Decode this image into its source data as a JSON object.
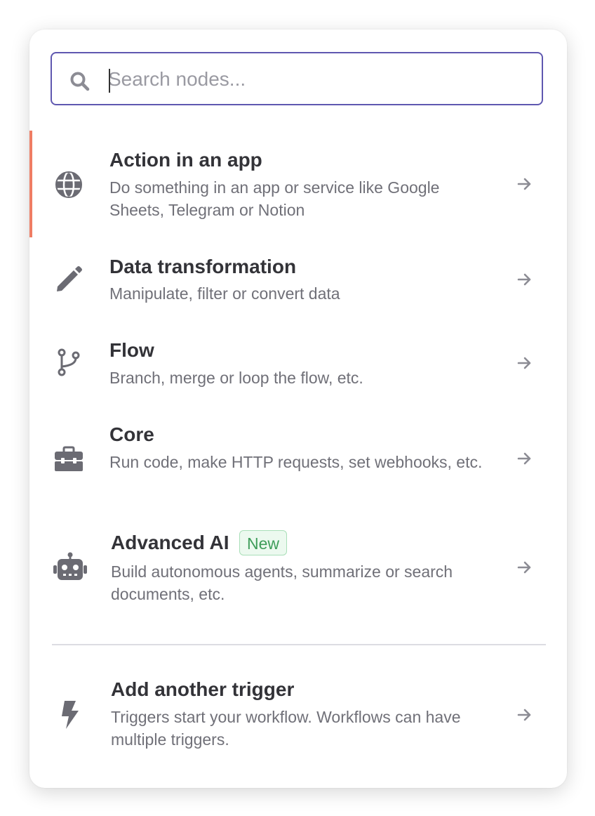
{
  "search": {
    "placeholder": "Search nodes...",
    "value": ""
  },
  "items": [
    {
      "title": "Action in an app",
      "description": "Do something in an app or service like Google Sheets, Telegram or Notion",
      "icon": "globe-icon",
      "active": true
    },
    {
      "title": "Data transformation",
      "description": "Manipulate, filter or convert data",
      "icon": "pencil-icon",
      "active": false
    },
    {
      "title": "Flow",
      "description": "Branch, merge or loop the flow, etc.",
      "icon": "branch-icon",
      "active": false
    },
    {
      "title": "Core",
      "description": "Run code, make HTTP requests, set webhooks, etc.",
      "icon": "toolbox-icon",
      "active": false
    },
    {
      "title": "Advanced AI",
      "badge": "New",
      "description": "Build autonomous agents, summarize or search documents, etc.",
      "icon": "robot-icon",
      "active": false
    }
  ],
  "trigger": {
    "title": "Add another trigger",
    "description": "Triggers start your workflow. Workflows can have multiple triggers.",
    "icon": "bolt-icon"
  },
  "colors": {
    "accent_border": "#5f58b0",
    "active_indicator": "#ef7d64",
    "badge_text": "#3f9d5a",
    "badge_bg": "#ecf9ef",
    "icon": "#6b6b73"
  }
}
